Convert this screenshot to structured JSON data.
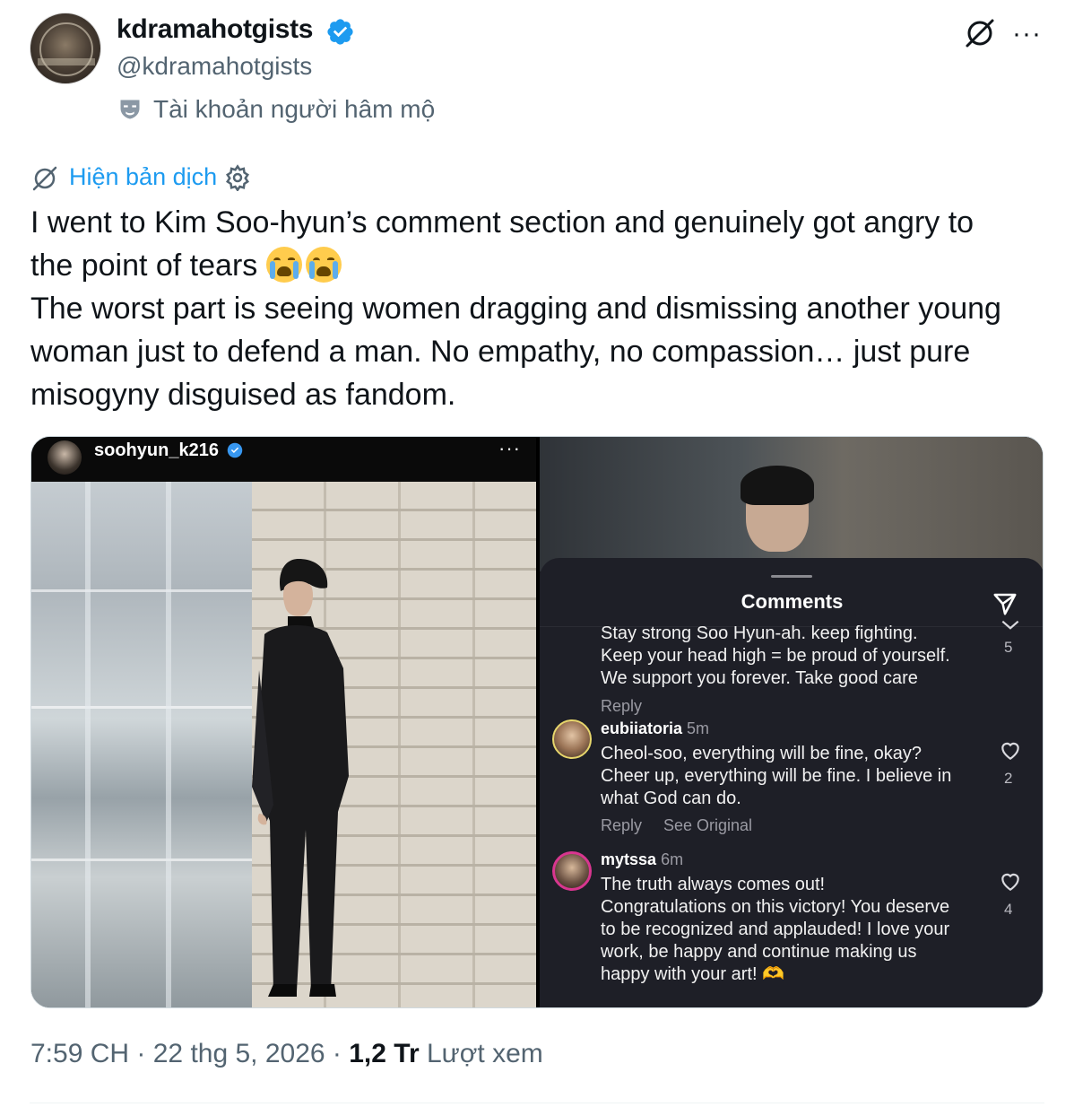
{
  "author": {
    "name": "kdramahotgists",
    "handle": "@kdramahotgists",
    "account_label": "Tài khoản người hâm mộ",
    "verified_color": "#1d9bf0"
  },
  "header_actions": {
    "grok_icon": "grok-icon",
    "more_icon": "more-icon",
    "more_glyph": "···"
  },
  "translate": {
    "label": "Hiện bản dịch"
  },
  "tweet": {
    "line1": "I went to Kim Soo-hyun’s comment section and genuinely got angry to",
    "line2": "the point of tears",
    "paragraph2": "The worst part is seeing women dragging and dismissing another young woman just to defend a man. No empathy, no compassion… just pure misogyny disguised as fandom."
  },
  "media": {
    "left": {
      "ig_username": "soohyun_k216",
      "ig_more": "···"
    },
    "right": {
      "sheet_title": "Comments",
      "comments": [
        {
          "text": "Stay strong Soo Hyun-ah. keep fighting.\nKeep your head high = be proud of yourself.\nWe support you forever. Take good care",
          "reply": "Reply",
          "likes": "5"
        },
        {
          "user": "eubiiatoria",
          "time": "5m",
          "text": "Cheol-soo, everything will be fine, okay?\nCheer up, everything will be fine. I believe in\nwhat God can do.",
          "reply": "Reply",
          "see_original": "See Original",
          "likes": "2"
        },
        {
          "user": "mytssa",
          "time": "6m",
          "text": "The truth always comes out!\nCongratulations on this victory! You deserve\nto be recognized and applauded! I love your\nwork, be happy and continue making us\nhappy with your art! 🫶",
          "likes": "4"
        }
      ]
    }
  },
  "meta": {
    "time": "7:59 CH",
    "sep1": " · ",
    "date": "22 thg 5, 2026",
    "sep2": " · ",
    "views_count": "1,2 Tr",
    "views_label": " Lượt xem"
  }
}
